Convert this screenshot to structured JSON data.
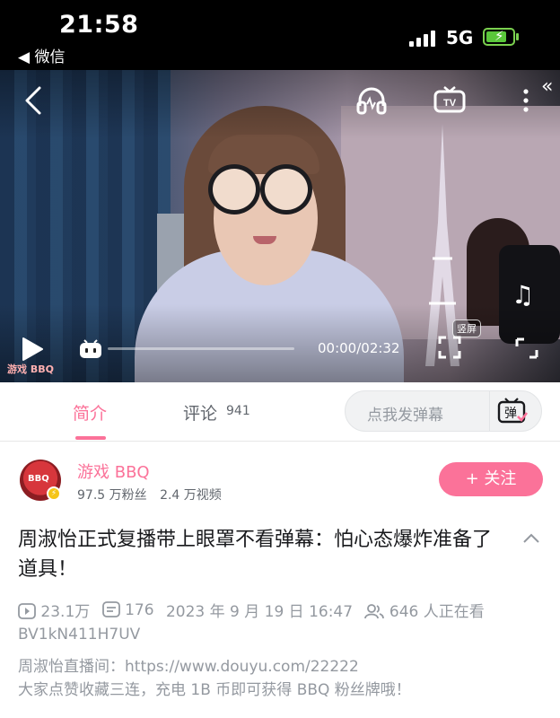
{
  "status_bar": {
    "time": "21:58",
    "back_app": "◀ 微信",
    "network": "5G",
    "battery_level": 0.8,
    "battery_color": "#5ac73a"
  },
  "player": {
    "time_display": "00:00/02:32",
    "vertical_screen_label": "竖屏",
    "watermark": "游戏 BBQ",
    "progress": 0.0,
    "icons": [
      "back-icon",
      "headphones-icon",
      "tv-cast-icon",
      "more-icon",
      "play-icon",
      "danmaku-toggle-icon",
      "fullscreen-icon",
      "rotate-icon",
      "music-icon"
    ]
  },
  "tabs": {
    "intro_label": "简介",
    "comments_label": "评论",
    "comments_count": "941",
    "danmaku_placeholder": "点我发弹幕",
    "danmaku_send_label": "弹",
    "accent_color": "#fb7299"
  },
  "uploader": {
    "name": "游戏 BBQ",
    "avatar_text": "BBQ",
    "followers": "97.5 万粉丝",
    "videos": "2.4 万视频",
    "follow_label": "+ 关注"
  },
  "video_info": {
    "title": "周淑怡正式复播带上眼罩不看弹幕：怕心态爆炸准备了道具！",
    "views": "23.1万",
    "danmaku_count": "176",
    "publish_time": "2023 年 9 月 19 日 16:47",
    "watching_now": "646 人正在看",
    "bvid": "BV1kN411H7UV",
    "desc_line1": "周淑怡直播间：https://www.douyu.com/22222",
    "desc_line2": "大家点赞收藏三连，充电 1B 币即可获得 BBQ 粉丝牌哦！"
  }
}
